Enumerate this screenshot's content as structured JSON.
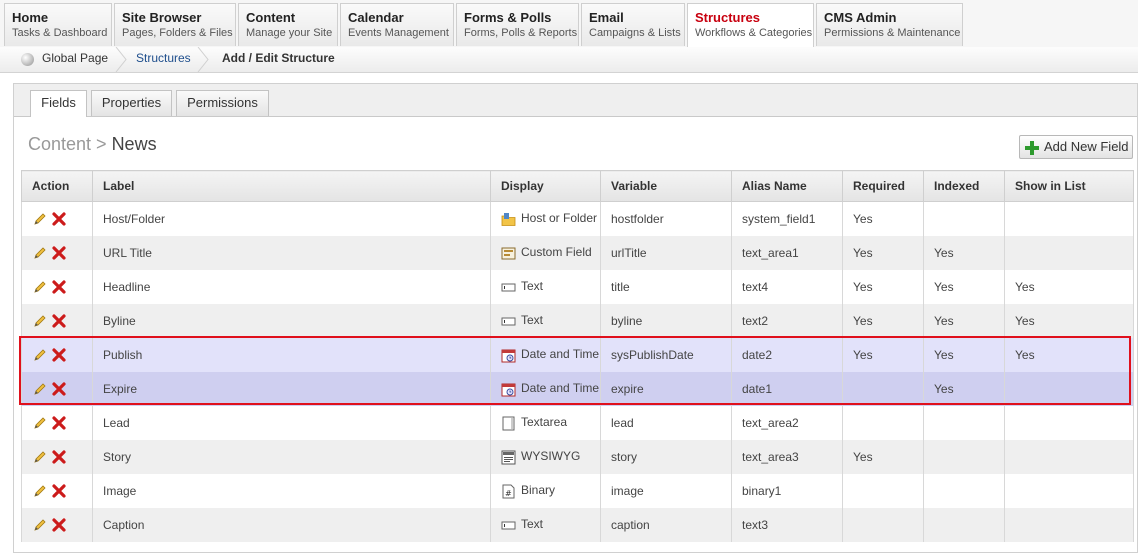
{
  "nav": [
    {
      "title": "Home",
      "sub": "Tasks & Dashboard"
    },
    {
      "title": "Site Browser",
      "sub": "Pages, Folders & Files"
    },
    {
      "title": "Content",
      "sub": "Manage your Site"
    },
    {
      "title": "Calendar",
      "sub": "Events Management"
    },
    {
      "title": "Forms & Polls",
      "sub": "Forms, Polls & Reports"
    },
    {
      "title": "Email",
      "sub": "Campaigns & Lists"
    },
    {
      "title": "Structures",
      "sub": "Workflows & Categories"
    },
    {
      "title": "CMS Admin",
      "sub": "Permissions & Maintenance"
    }
  ],
  "breadcrumb": {
    "home": "Global Page",
    "parent": "Structures",
    "current": "Add / Edit Structure"
  },
  "tabs": [
    "Fields",
    "Properties",
    "Permissions"
  ],
  "heading": {
    "parent": "Content",
    "separator": " > ",
    "current": "News"
  },
  "add_button": "Add New Field",
  "columns": [
    "Action",
    "Label",
    "Display",
    "Variable",
    "Alias Name",
    "Required",
    "Indexed",
    "Show in List"
  ],
  "rows": [
    {
      "label": "Host/Folder",
      "display": "Host or Folder",
      "display_icon": "host-folder-icon",
      "variable": "hostfolder",
      "alias": "system_field1",
      "required": "Yes",
      "indexed": "",
      "show": ""
    },
    {
      "label": "URL Title",
      "display": "Custom Field",
      "display_icon": "custom-field-icon",
      "variable": "urlTitle",
      "alias": "text_area1",
      "required": "Yes",
      "indexed": "Yes",
      "show": ""
    },
    {
      "label": "Headline",
      "display": "Text",
      "display_icon": "text-field-icon",
      "variable": "title",
      "alias": "text4",
      "required": "Yes",
      "indexed": "Yes",
      "show": "Yes"
    },
    {
      "label": "Byline",
      "display": "Text",
      "display_icon": "text-field-icon",
      "variable": "byline",
      "alias": "text2",
      "required": "Yes",
      "indexed": "Yes",
      "show": "Yes"
    },
    {
      "label": "Publish",
      "display": "Date and Time",
      "display_icon": "calendar-clock-icon",
      "variable": "sysPublishDate",
      "alias": "date2",
      "required": "Yes",
      "indexed": "Yes",
      "show": "Yes"
    },
    {
      "label": "Expire",
      "display": "Date and Time",
      "display_icon": "calendar-clock-icon",
      "variable": "expire",
      "alias": "date1",
      "required": "",
      "indexed": "Yes",
      "show": ""
    },
    {
      "label": "Lead",
      "display": "Textarea",
      "display_icon": "textarea-icon",
      "variable": "lead",
      "alias": "text_area2",
      "required": "",
      "indexed": "",
      "show": ""
    },
    {
      "label": "Story",
      "display": "WYSIWYG",
      "display_icon": "wysiwyg-icon",
      "variable": "story",
      "alias": "text_area3",
      "required": "Yes",
      "indexed": "",
      "show": ""
    },
    {
      "label": "Image",
      "display": "Binary",
      "display_icon": "binary-icon",
      "variable": "image",
      "alias": "binary1",
      "required": "",
      "indexed": "",
      "show": ""
    },
    {
      "label": "Caption",
      "display": "Text",
      "display_icon": "text-field-icon",
      "variable": "caption",
      "alias": "text3",
      "required": "",
      "indexed": "",
      "show": ""
    }
  ],
  "colors": {
    "active_nav": "#c8000f",
    "link": "#1e4e8c",
    "highlight_border": "#e0101c",
    "highlight_row_1": "#e2e2fa",
    "highlight_row_2": "#cfcff0"
  }
}
